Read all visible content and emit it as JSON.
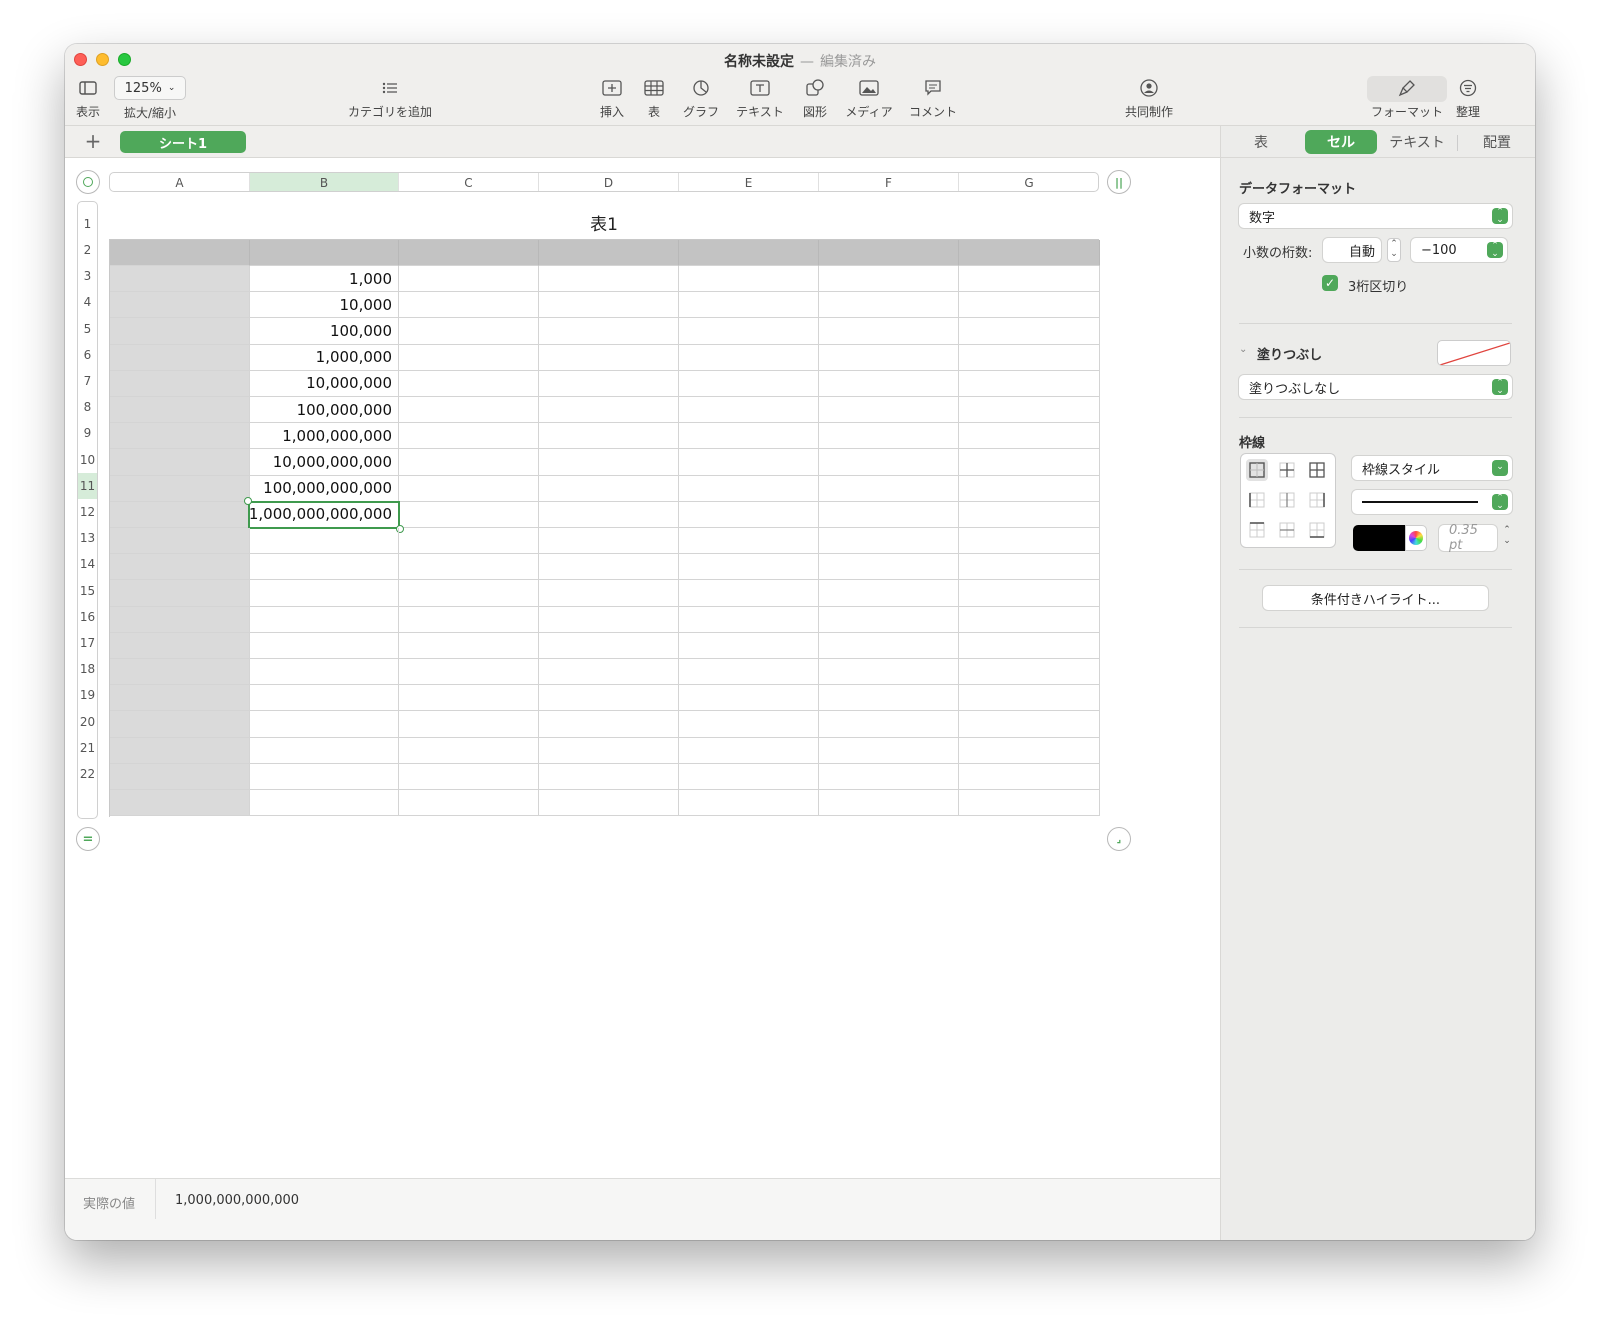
{
  "window": {
    "title": "名称未設定",
    "separator": "—",
    "status": "編集済み"
  },
  "toolbar": {
    "view_label": "表示",
    "zoom_value": "125%",
    "zoom_label": "拡大/縮小",
    "category_label": "カテゴリを追加",
    "insert_label": "挿入",
    "table_label": "表",
    "chart_label": "グラフ",
    "text_label": "テキスト",
    "shape_label": "図形",
    "media_label": "メディア",
    "comment_label": "コメント",
    "collab_label": "共同制作",
    "format_label": "フォーマット",
    "organize_label": "整理"
  },
  "sheets": {
    "add": "+",
    "active": "シート1"
  },
  "sidebar_tabs": {
    "table": "表",
    "cell": "セル",
    "text": "テキスト",
    "arrange": "配置"
  },
  "sidebar": {
    "data_format_heading": "データフォーマット",
    "data_format_value": "数字",
    "decimals_label": "小数の桁数:",
    "decimals_value": "自動",
    "negative_value": "−100",
    "thousands_label": "3桁区切り",
    "thousands_checked": true,
    "fill_heading": "塗りつぶし",
    "fill_value": "塗りつぶしなし",
    "border_heading": "枠線",
    "border_style_value": "枠線スタイル",
    "border_width": "0.35 pt",
    "conditional_button": "条件付きハイライト..."
  },
  "table": {
    "title": "表1",
    "columns": [
      "A",
      "B",
      "C",
      "D",
      "E",
      "F",
      "G"
    ],
    "selected_column": "B",
    "rows": [
      "1",
      "2",
      "3",
      "4",
      "5",
      "6",
      "7",
      "8",
      "9",
      "10",
      "11",
      "12",
      "13",
      "14",
      "15",
      "16",
      "17",
      "18",
      "19",
      "20",
      "21",
      "22"
    ],
    "selected_row": "11",
    "column_b_values": [
      "",
      "1,000",
      "10,000",
      "100,000",
      "1,000,000",
      "10,000,000",
      "100,000,000",
      "1,000,000,000",
      "10,000,000,000",
      "100,000,000,000",
      "1,000,000,000,000",
      "",
      "",
      "",
      "",
      "",
      "",
      "",
      "",
      "",
      "",
      ""
    ]
  },
  "status": {
    "label": "実際の値",
    "value": "1,000,000,000,000"
  },
  "colors": {
    "accent": "#4fa85a",
    "header_row": "#c3c3c3",
    "header_col": "#dadada"
  }
}
